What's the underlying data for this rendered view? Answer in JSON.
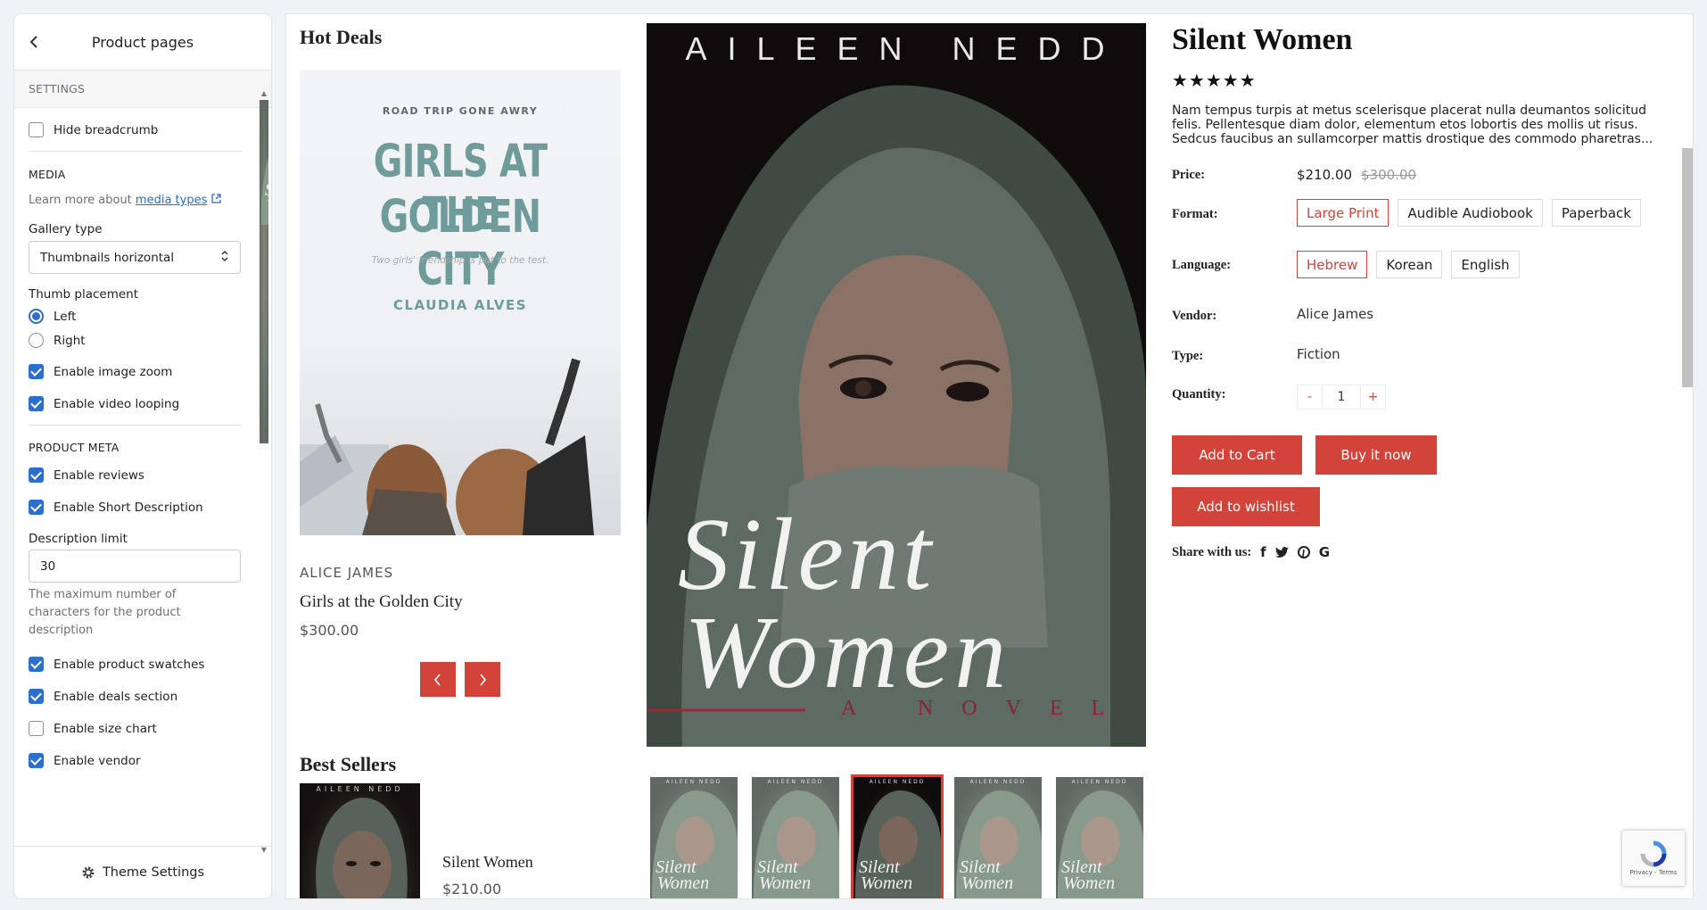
{
  "sidebar": {
    "title": "Product pages",
    "settings_header": "SETTINGS",
    "hide_breadcrumb": "Hide breadcrumb",
    "media_header": "MEDIA",
    "learn_more_prefix": "Learn more about ",
    "learn_more_link": "media types",
    "gallery_type_label": "Gallery type",
    "gallery_type_value": "Thumbnails horizontal",
    "thumb_placement_label": "Thumb placement",
    "thumb_left": "Left",
    "thumb_right": "Right",
    "enable_image_zoom": "Enable image zoom",
    "enable_video_looping": "Enable video looping",
    "product_meta_header": "PRODUCT META",
    "enable_reviews": "Enable reviews",
    "enable_short_description": "Enable Short Description",
    "description_limit_label": "Description limit",
    "description_limit_value": "30",
    "description_help": "The maximum number of characters for the product description",
    "enable_product_swatches": "Enable product swatches",
    "enable_deals_section": "Enable deals section",
    "enable_size_chart": "Enable size chart",
    "enable_vendor": "Enable vendor",
    "footer": "Theme Settings"
  },
  "hot_deals": {
    "title": "Hot Deals",
    "cover": {
      "kicker": "ROAD TRIP GONE AWRY",
      "title_line1": "GIRLS AT THE",
      "title_line2": "GOLDEN CITY",
      "tagline": "Two girls' friendship is put to the test.",
      "author": "CLAUDIA ALVES"
    },
    "vendor": "ALICE JAMES",
    "name": "Girls at the Golden City",
    "price": "$300.00"
  },
  "best_sellers": {
    "title": "Best Sellers",
    "name": "Silent Women",
    "price": "$210.00"
  },
  "main_cover": {
    "author": "AILEEN NEDD",
    "title_line1": "Silent",
    "title_line2": "Women",
    "subtitle": "A NOVEL"
  },
  "product": {
    "title": "Silent Women",
    "stars": "★★★★★",
    "description": "Nam tempus turpis at metus scelerisque placerat nulla deumantos solicitud felis. Pellentesque diam dolor, elementum etos lobortis des mollis ut risus. Sedcus faucibus an sullamcorper mattis drostique des commodo pharetras...",
    "price_label": "Price:",
    "price": "$210.00",
    "compare_price": "$300.00",
    "format_label": "Format:",
    "formats": [
      "Large Print",
      "Audible Audiobook",
      "Paperback"
    ],
    "language_label": "Language:",
    "languages": [
      "Hebrew",
      "Korean",
      "English"
    ],
    "vendor_label": "Vendor:",
    "vendor": "Alice James",
    "type_label": "Type:",
    "type": "Fiction",
    "quantity_label": "Quantity:",
    "qty_minus": "-",
    "quantity": "1",
    "qty_plus": "+",
    "add_to_cart": "Add to Cart",
    "buy_now": "Buy it now",
    "add_to_wishlist": "Add to wishlist",
    "share_label": "Share with us:",
    "share_icons": [
      "f",
      "t",
      "p",
      "G"
    ]
  },
  "thumbs": {
    "cover_author": "AILEEN NEDD",
    "cover_line1": "Silent",
    "cover_line2": "Women"
  },
  "recaptcha": {
    "text": "Privacy - Terms"
  },
  "colors": {
    "accent": "#d2433a",
    "admin_blue": "#2c6ecb"
  }
}
